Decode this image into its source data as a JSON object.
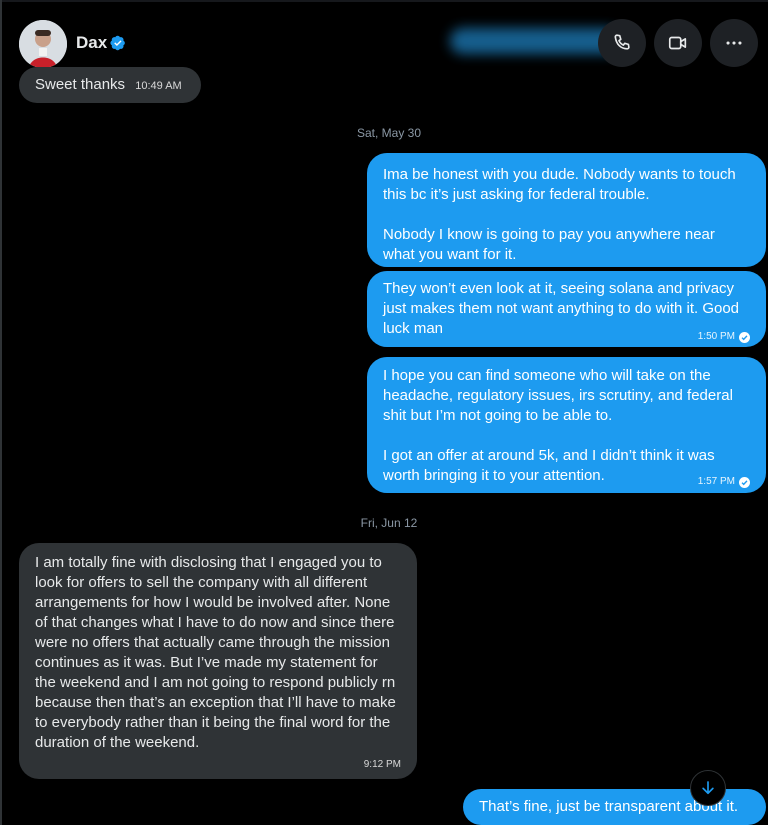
{
  "contact": {
    "name": "Dax",
    "verified": true
  },
  "colors": {
    "background": "#000000",
    "incoming_bubble": "#2f3336",
    "outgoing_bubble": "#1d9bf0",
    "accent": "#1d9bf0",
    "secondary_text": "#8b98a5"
  },
  "header": {
    "actions": [
      {
        "icon": "phone-icon"
      },
      {
        "icon": "video-camera-icon"
      },
      {
        "icon": "more-options-icon"
      }
    ]
  },
  "messages": {
    "m1": {
      "text": "Sweet thanks",
      "time": "10:49 AM"
    },
    "sep1": "Sat, May 30",
    "m2": {
      "text": "Ima be honest with you dude. Nobody wants to touch this bc it’s just asking for federal trouble.\n\nNobody I know is going to pay you anywhere near what you want for it."
    },
    "m3": {
      "text": "They won’t even look at it, seeing solana and privacy just makes them not want anything to do with it. Good luck man",
      "time": "1:50 PM"
    },
    "m4": {
      "text": "I hope you can find someone who will take on the headache, regulatory issues, irs scrutiny, and federal shit but I’m not going to be able to.\n\nI got an offer at around 5k, and I didn’t think it was worth bringing it to your attention.",
      "time": "1:57 PM"
    },
    "sep2": "Fri, Jun 12",
    "m5": {
      "text": "I am totally fine with disclosing that I engaged you to look for offers to sell the company with all different arrangements for how I would be involved after. None of that changes what I have to do now and since there were no offers that actually came through the mission continues as it was. But I’ve made my statement for the weekend and I am not going to respond publicly rn because then that’s an exception that I’ll have to make to everybody rather than it being the final word for the duration of the weekend.",
      "time": "9:12 PM"
    },
    "m6": {
      "text": "That’s fine, just be transparent about it."
    }
  }
}
